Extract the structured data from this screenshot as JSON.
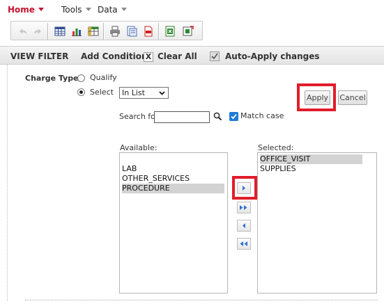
{
  "menu": {
    "home": "Home",
    "tools": "Tools",
    "data": "Data"
  },
  "toolbar": {
    "buttons": [
      "undo-icon",
      "redo-icon",
      "table-icon",
      "chart-icon",
      "pivot-icon",
      "print-icon",
      "export-icon",
      "pdf-icon",
      "excel-icon",
      "refresh-icon"
    ]
  },
  "filter_header": {
    "view_filter": "VIEW FILTER",
    "add_condition": "Add Condition",
    "clear_all": "Clear All",
    "clear_all_icon": "X",
    "auto_apply": "Auto-Apply changes"
  },
  "condition": {
    "field_label": "Charge Type",
    "radio_qualify": "Qualify",
    "radio_select": "Select",
    "select_value": "In List",
    "search_label": "Search for:",
    "search_value": "",
    "match_case": "Match case",
    "apply": "Apply",
    "cancel": "Cancel"
  },
  "available": {
    "label": "Available:",
    "items": [
      "LAB",
      "OTHER_SERVICES",
      "PROCEDURE"
    ],
    "selected_item": "PROCEDURE"
  },
  "selected": {
    "label": "Selected:",
    "items": [
      "OFFICE_VISIT",
      "SUPPLIES"
    ],
    "highlighted_item": "OFFICE_VISIT"
  },
  "move_buttons": [
    "move-right-icon",
    "move-all-right-icon",
    "move-left-icon",
    "move-all-left-icon"
  ],
  "colors": {
    "highlight": "#e11d2a",
    "home": "#c8102e",
    "checkbox": "#1e7ad6"
  }
}
